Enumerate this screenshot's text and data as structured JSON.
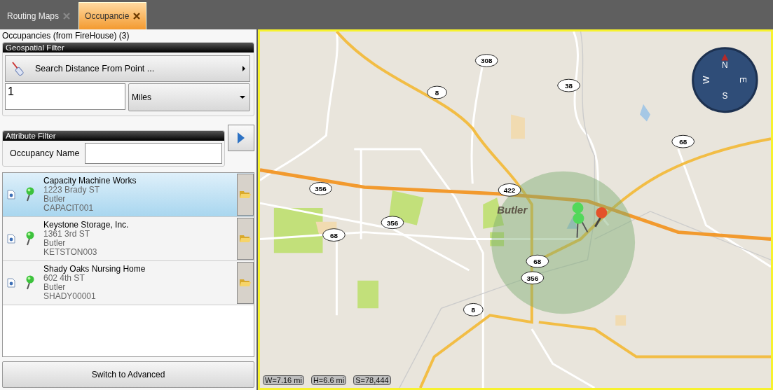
{
  "tabs": [
    {
      "label": "Routing Maps",
      "selected": false
    },
    {
      "label": "Occupancie",
      "selected": true
    }
  ],
  "panel_title": "Occupancies (from FireHouse) (3)",
  "geospatial_filter": {
    "title": "Geospatial Filter",
    "search_button": "Search  Distance From Point ...",
    "distance_value": "1",
    "unit": "Miles"
  },
  "attribute_filter": {
    "title": "Attribute Filter",
    "name_label": "Occupancy Name"
  },
  "occupancies": [
    {
      "name": "Capacity Machine Works",
      "address": "1223 Brady ST",
      "city": "Butler",
      "code": "CAPACIT001",
      "selected": true
    },
    {
      "name": "Keystone Storage, Inc.",
      "address": "1361 3rd ST",
      "city": "Butler",
      "code": "KETSTON003",
      "selected": false
    },
    {
      "name": "Shady Oaks Nursing Home",
      "address": "602 4th ST",
      "city": "Butler",
      "code": "SHADY00001",
      "selected": false
    }
  ],
  "advanced_button": "Switch to Advanced",
  "map": {
    "road_labels": [
      "308",
      "8",
      "38",
      "68",
      "356",
      "422",
      "356",
      "68",
      "68",
      "356",
      "8"
    ],
    "place_label": "Butler",
    "compass": [
      "N",
      "E",
      "S",
      "W"
    ],
    "scale": [
      "W=7.16 mi",
      "H=6.6 mi",
      "S=78,444"
    ]
  }
}
